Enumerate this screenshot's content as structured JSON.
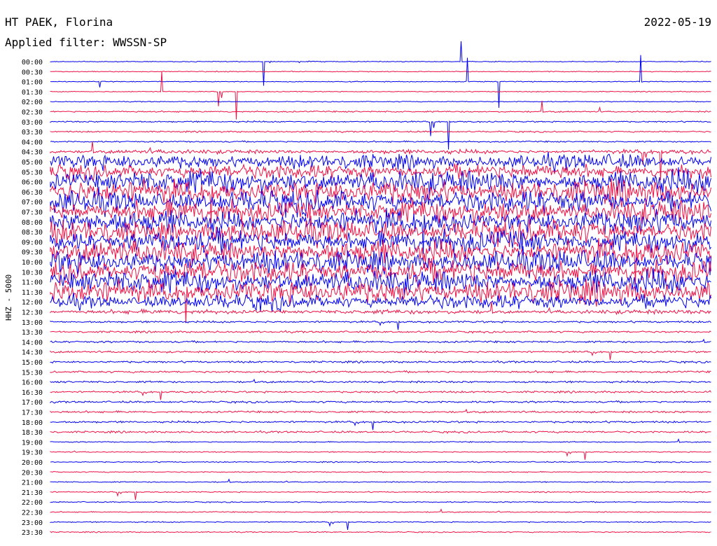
{
  "chart_data": {
    "type": "line",
    "title": "HT PAEK, Florina",
    "subtitle": "Applied filter: WWSSN-SP",
    "date": "2022-05-19",
    "ylabel": "HHZ - 5000",
    "y_ticks": [
      "00:00",
      "00:30",
      "01:00",
      "01:30",
      "02:00",
      "02:30",
      "03:00",
      "03:30",
      "04:00",
      "04:30",
      "05:00",
      "05:30",
      "06:00",
      "06:30",
      "07:00",
      "07:30",
      "08:00",
      "08:30",
      "09:00",
      "09:30",
      "10:00",
      "10:30",
      "11:00",
      "11:30",
      "12:00",
      "12:30",
      "13:00",
      "13:30",
      "14:00",
      "14:30",
      "15:00",
      "15:30",
      "16:00",
      "16:30",
      "17:00",
      "17:30",
      "18:00",
      "18:30",
      "19:00",
      "19:30",
      "20:00",
      "20:30",
      "21:00",
      "21:30",
      "22:00",
      "22:30",
      "23:00",
      "23:30"
    ],
    "colors": {
      "even": "#0000ee",
      "odd": "#ee1144"
    },
    "grid": false,
    "legend": "none"
  }
}
